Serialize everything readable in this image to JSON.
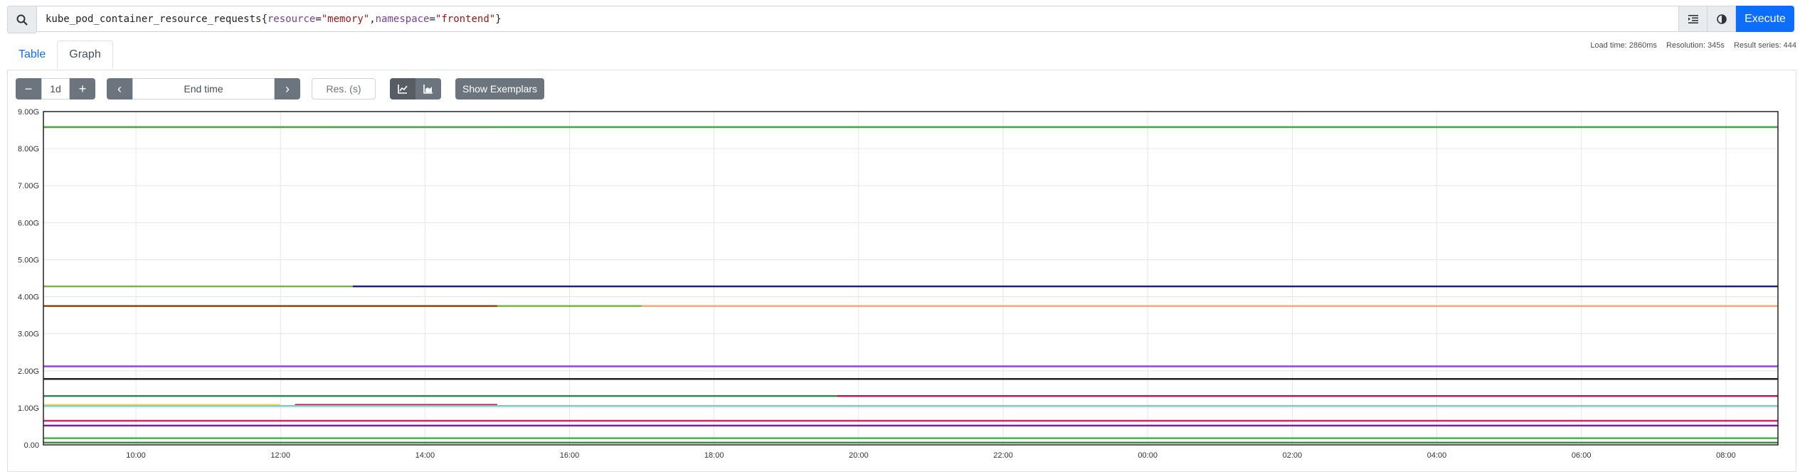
{
  "query": {
    "metric": "kube_pod_container_resource_requests",
    "label1_key": "resource",
    "label1_val": "\"memory\"",
    "label2_key": "namespace",
    "label2_val": "\"frontend\"",
    "execute_label": "Execute"
  },
  "tabs": [
    "Table",
    "Graph"
  ],
  "stats": {
    "load_time": "Load time: 2860ms",
    "resolution": "Resolution: 345s",
    "result_series": "Result series: 444"
  },
  "controls": {
    "minus": "−",
    "range": "1d",
    "plus": "+",
    "prev": "‹",
    "end_time_placeholder": "End time",
    "next": "›",
    "res_placeholder": "Res. (s)",
    "show_exemplars": "Show Exemplars"
  },
  "chart_data": {
    "type": "line",
    "yticks": [
      "0.00",
      "1.00G",
      "2.00G",
      "3.00G",
      "4.00G",
      "5.00G",
      "6.00G",
      "7.00G",
      "8.00G",
      "9.00G"
    ],
    "xticks": [
      "10:00",
      "12:00",
      "14:00",
      "16:00",
      "18:00",
      "20:00",
      "22:00",
      "00:00",
      "02:00",
      "04:00",
      "06:00",
      "08:00"
    ],
    "ylim": [
      0,
      9
    ],
    "x_range_hours": [
      8.72,
      32.72
    ],
    "series": [
      {
        "color": "#cb4b4b",
        "segments": [
          [
            8.72,
            8.58,
            12.6
          ],
          [
            12.6,
            8.58,
            15.0
          ],
          [
            15.0,
            8.58,
            32.72
          ]
        ],
        "seg_colors": [
          "#cb4b4b",
          "#9440ed",
          "#4da74d"
        ]
      },
      {
        "color": "#4da74d",
        "segments": [
          [
            8.72,
            8.58,
            32.72
          ]
        ],
        "seg_colors": [
          "#4da74d"
        ]
      },
      {
        "color": "#afd8f8",
        "segments": [
          [
            8.72,
            4.28,
            13.0
          ],
          [
            13.0,
            4.28,
            32.72
          ]
        ],
        "seg_colors": [
          "#7cb342",
          "#1a237e"
        ]
      },
      {
        "color": "#edc240",
        "segments": [
          [
            8.72,
            3.75,
            15.0
          ],
          [
            15.0,
            3.75,
            17.0
          ],
          [
            17.0,
            3.75,
            32.72
          ]
        ],
        "seg_colors": [
          "#8b4513",
          "#7cb342",
          "#f4a582"
        ]
      },
      {
        "color": "#9440ed",
        "segments": [
          [
            8.72,
            2.12,
            32.72
          ]
        ],
        "seg_colors": [
          "#9440ed"
        ]
      },
      {
        "color": "#222222",
        "segments": [
          [
            8.72,
            1.78,
            32.72
          ]
        ],
        "seg_colors": [
          "#222222"
        ]
      },
      {
        "color": "#2e8b57",
        "segments": [
          [
            8.72,
            1.32,
            19.7
          ],
          [
            19.7,
            1.32,
            32.72
          ]
        ],
        "seg_colors": [
          "#2e8b57",
          "#c2185b"
        ]
      },
      {
        "color": "#ffd54f",
        "segments": [
          [
            8.72,
            1.08,
            12.0
          ],
          [
            12.2,
            1.08,
            15.0
          ]
        ],
        "seg_colors": [
          "#ffd54f",
          "#c2185b"
        ]
      },
      {
        "color": "#26a69a",
        "segments": [
          [
            8.72,
            1.05,
            32.72
          ]
        ],
        "seg_colors": [
          "#80cbc4"
        ]
      },
      {
        "color": "#e91e63",
        "segments": [
          [
            8.72,
            0.65,
            32.72
          ]
        ],
        "seg_colors": [
          "#e91e63"
        ]
      },
      {
        "color": "#5e35b1",
        "segments": [
          [
            8.72,
            0.52,
            32.72
          ]
        ],
        "seg_colors": [
          "#7b1fa2"
        ]
      },
      {
        "color": "#4caf50",
        "segments": [
          [
            8.72,
            0.18,
            32.72
          ]
        ],
        "seg_colors": [
          "#4caf50"
        ]
      },
      {
        "color": "#388e3c",
        "segments": [
          [
            8.72,
            0.06,
            32.72
          ]
        ],
        "seg_colors": [
          "#388e3c"
        ]
      }
    ]
  }
}
